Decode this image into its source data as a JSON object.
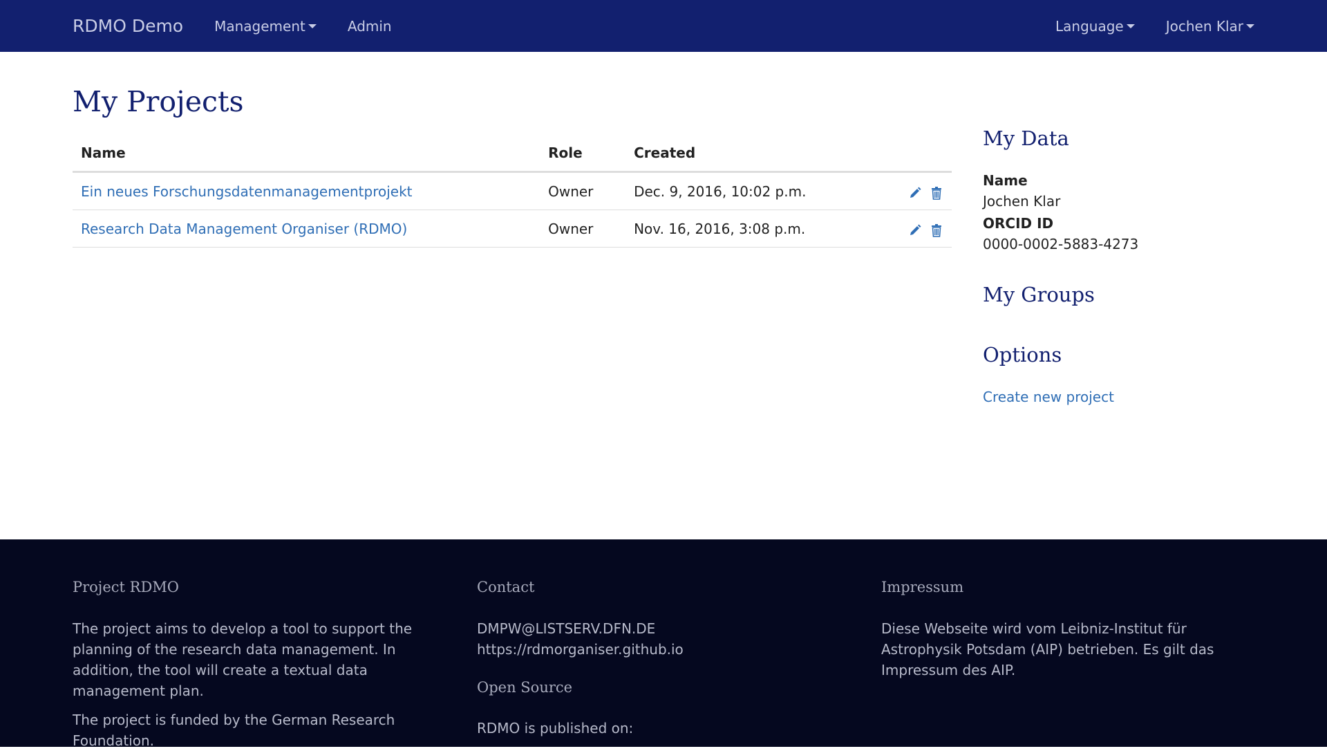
{
  "navbar": {
    "brand": "RDMO Demo",
    "management": "Management",
    "admin": "Admin",
    "language": "Language",
    "user": "Jochen Klar"
  },
  "main": {
    "title": "My Projects",
    "table": {
      "headers": {
        "name": "Name",
        "role": "Role",
        "created": "Created"
      },
      "rows": [
        {
          "name": "Ein neues Forschungsdatenmanagementprojekt",
          "role": "Owner",
          "created": "Dec. 9, 2016, 10:02 p.m."
        },
        {
          "name": "Research Data Management Organiser (RDMO)",
          "role": "Owner",
          "created": "Nov. 16, 2016, 3:08 p.m."
        }
      ]
    }
  },
  "sidebar": {
    "my_data_title": "My Data",
    "name_label": "Name",
    "name_value": "Jochen Klar",
    "orcid_label": "ORCID ID",
    "orcid_value": "0000-0002-5883-4273",
    "groups_title": "My Groups",
    "options_title": "Options",
    "create_link": "Create new project"
  },
  "footer": {
    "project_title": "Project RDMO",
    "project_text_1": "The project aims to develop a tool to support the planning of the research data management. In addition, the tool will create a textual data management plan.",
    "project_text_2": "The project is funded by the German Research Foundation.",
    "contact_title": "Contact",
    "contact_email": "DMPW@LISTSERV.DFN.DE",
    "contact_url": "https://rdmorganiser.github.io",
    "open_source_title": "Open Source",
    "open_source_text": "RDMO is published on:",
    "impressum_title": "Impressum",
    "impressum_text": "Diese Webseite wird vom Leibniz-Institut für Astrophysik Potsdam (AIP) betrieben. Es gilt das Impressum des AIP."
  },
  "colors": {
    "navbar": "#12206f",
    "link": "#2f6eb5",
    "footer": "#05081f"
  }
}
